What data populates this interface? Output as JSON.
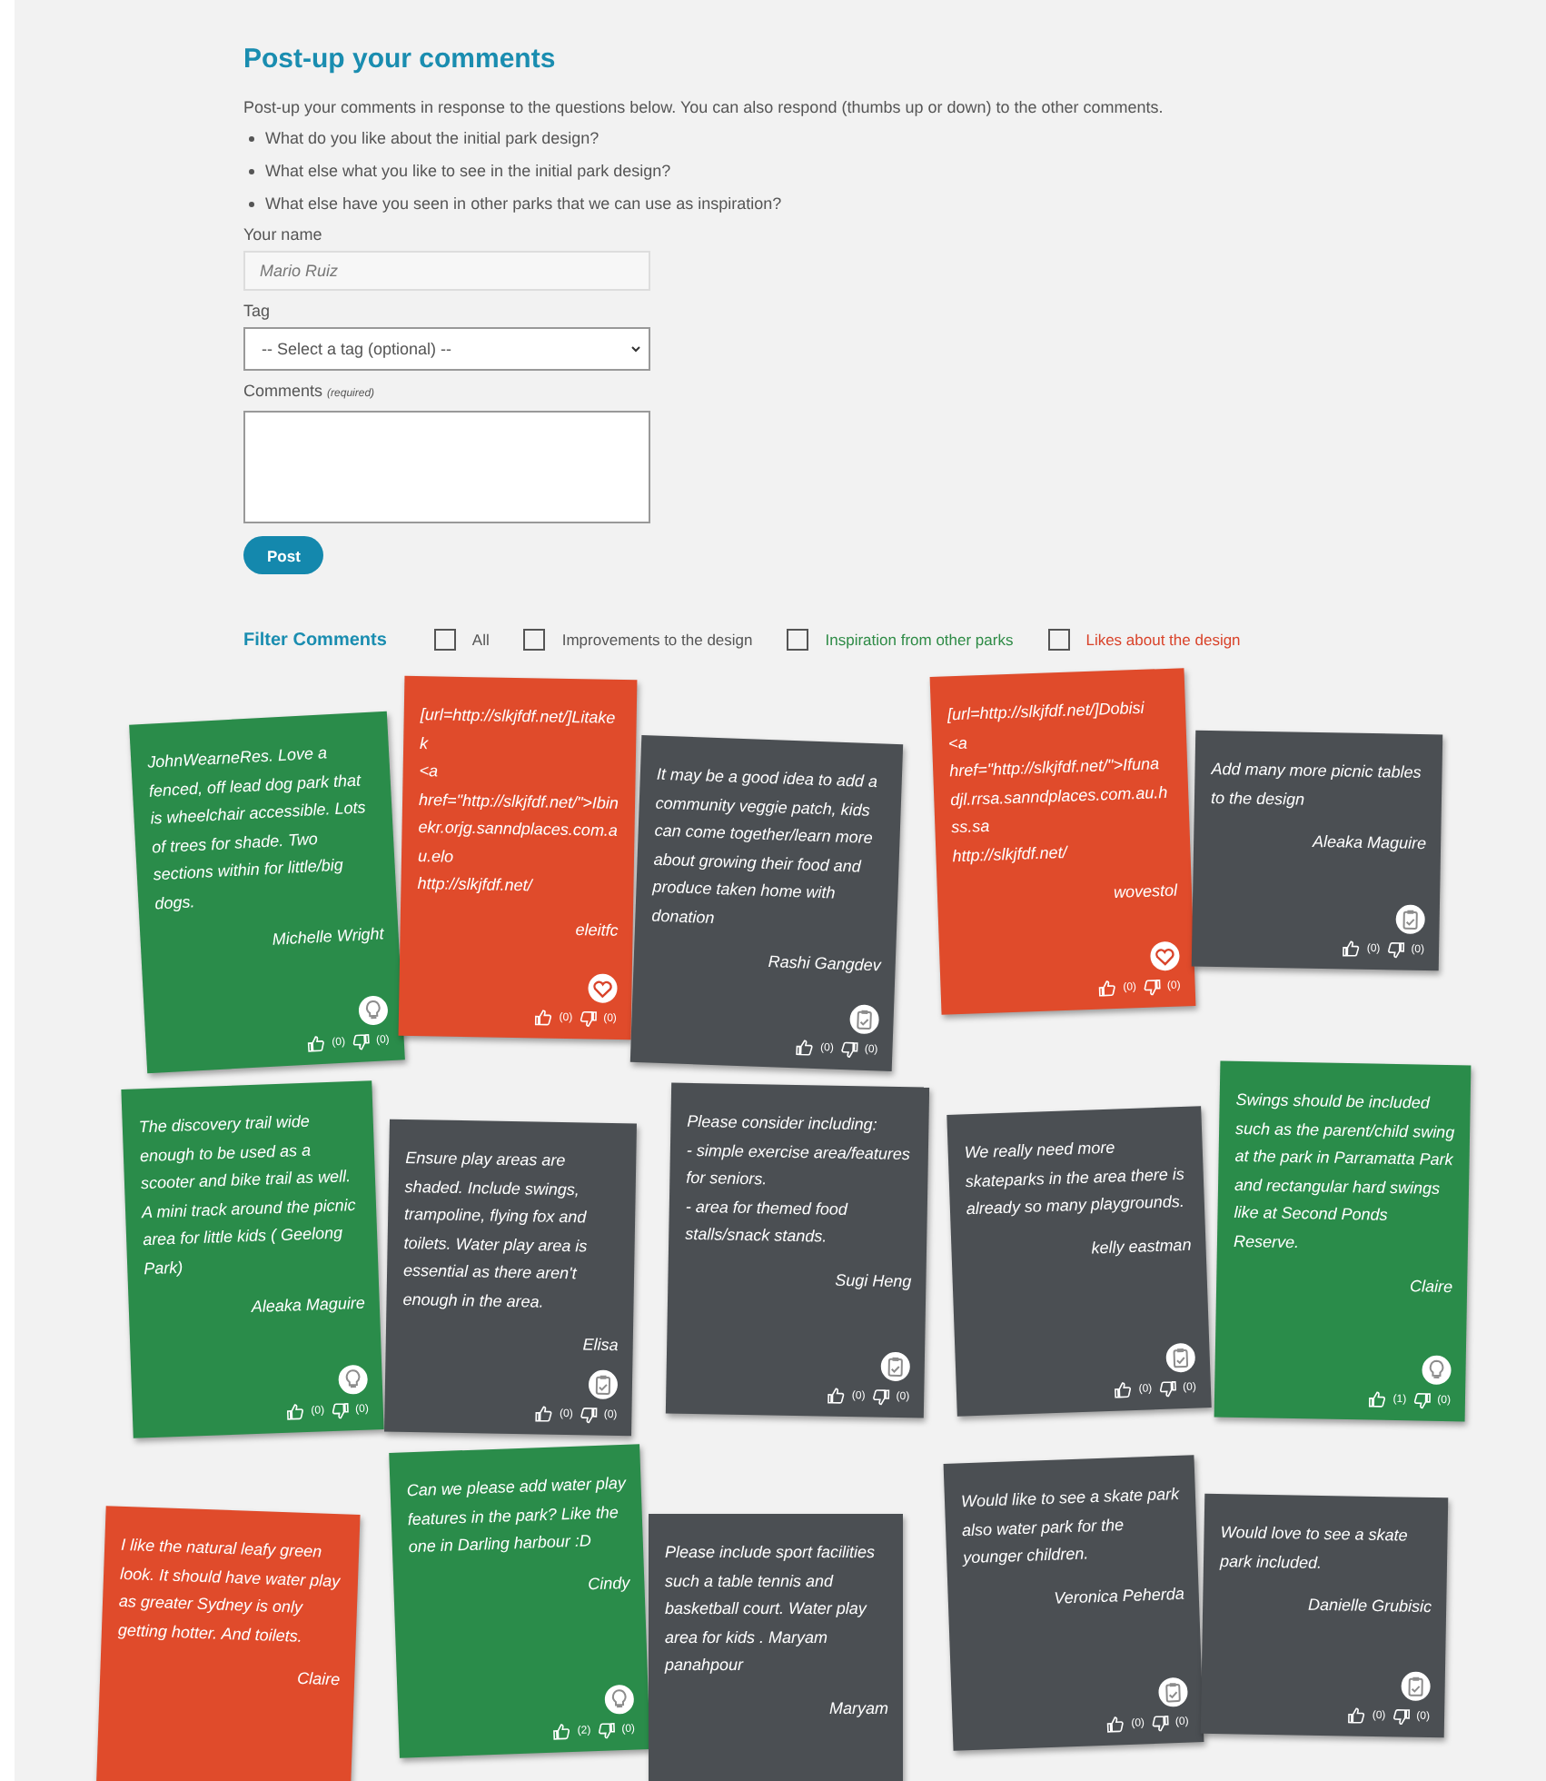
{
  "heading": "Post-up your comments",
  "intro": "Post-up your comments in response to the questions below. You can also respond (thumbs up or down) to the other comments.",
  "questions": [
    "What do you like about the initial park design?",
    "What else what you like to see in the initial park design?",
    "What else have you seen in other parks that we can use as inspiration?"
  ],
  "form": {
    "name_label": "Your name",
    "name_placeholder": "Mario Ruiz",
    "tag_label": "Tag",
    "tag_value": "-- Select a tag (optional) --",
    "comments_label": "Comments",
    "comments_hint": "(required)",
    "post_button": "Post"
  },
  "filter": {
    "title": "Filter Comments",
    "options": [
      {
        "label": "All",
        "checked": false,
        "color": "#555555"
      },
      {
        "label": "Improvements to the design",
        "checked": false,
        "color": "#555555"
      },
      {
        "label": "Inspiration from other parks",
        "checked": false,
        "color": "#2e8b46"
      },
      {
        "label": "Likes about the design",
        "checked": false,
        "color": "#d9432a"
      }
    ]
  },
  "notes": [
    {
      "kind": "inspiration",
      "text": "JohnWearneRes. Love a fenced, off lead dog park that is wheelchair accessible. Lots of trees for shade. Two sections within for little/big dogs.",
      "author": "Michelle Wright",
      "likes": "(0)",
      "dislikes": "(0)"
    },
    {
      "kind": "like",
      "text": "[url=http://slkjfdf.net/]Litakek\n<a\nhref=\"http://slkjfdf.net/\">Ibin\nekr.orjg.sanndplaces.com.au.elo\nhttp://slkjfdf.net/",
      "author": "eleitfc",
      "likes": "(0)",
      "dislikes": "(0)"
    },
    {
      "kind": "improvement",
      "text": "It may be a good idea to add a community veggie patch, kids can come together/learn more about growing their food and produce taken home with donation",
      "author": "Rashi Gangdev",
      "likes": "(0)",
      "dislikes": "(0)"
    },
    {
      "kind": "like",
      "text": "[url=http://slkjfdf.net/]Dobisi\n<a\nhref=\"http://slkjfdf.net/\">Ifuna\ndjl.rrsa.sanndplaces.com.au.hss.sa\nhttp://slkjfdf.net/",
      "author": "wovestol",
      "likes": "(0)",
      "dislikes": "(0)"
    },
    {
      "kind": "improvement",
      "text": "Add many more picnic tables to the design",
      "author": "Aleaka Maguire",
      "likes": "(0)",
      "dislikes": "(0)"
    },
    {
      "kind": "inspiration",
      "text": "The discovery trail wide enough to be used as a scooter and bike trail as well.\nA mini track around the picnic area for little kids ( Geelong Park)",
      "author": "Aleaka Maguire",
      "likes": "(0)",
      "dislikes": "(0)"
    },
    {
      "kind": "improvement",
      "text": "Ensure play areas are shaded. Include swings, trampoline, flying fox and toilets. Water play area is essential as there aren't enough in the area.",
      "author": "Elisa",
      "likes": "(0)",
      "dislikes": "(0)"
    },
    {
      "kind": "improvement",
      "text": "Please consider including:\n- simple exercise area/features for seniors.\n- area for themed food stalls/snack stands.",
      "author": "Sugi Heng",
      "likes": "(0)",
      "dislikes": "(0)"
    },
    {
      "kind": "improvement",
      "text": "We really need more skateparks in the area there is already so many playgrounds.",
      "author": "kelly eastman",
      "likes": "(0)",
      "dislikes": "(0)"
    },
    {
      "kind": "inspiration",
      "text": "Swings should be included such as the parent/child swing at the park in Parramatta Park and rectangular hard swings like at Second Ponds Reserve.",
      "author": "Claire",
      "likes": "(1)",
      "dislikes": "(0)"
    },
    {
      "kind": "like",
      "text": "I like the natural leafy green look. It should have water play as greater Sydney is only getting hotter. And toilets.",
      "author": "Claire"
    },
    {
      "kind": "inspiration",
      "text": "Can we please add water play features in the park? Like the one in Darling harbour :D",
      "author": "Cindy",
      "likes": "(2)",
      "dislikes": "(0)"
    },
    {
      "kind": "improvement",
      "text": "Please include sport facilities such a table tennis and basketball court. Water play area for kids . Maryam panahpour",
      "author": "Maryam"
    },
    {
      "kind": "improvement",
      "text": "Would like to see a skate park also water park for the younger children.",
      "author": "Veronica Peherda",
      "likes": "(0)",
      "dislikes": "(0)"
    },
    {
      "kind": "improvement",
      "text": "Would love to see a skate park included.",
      "author": "Danielle Grubisic",
      "likes": "(0)",
      "dislikes": "(0)"
    }
  ]
}
